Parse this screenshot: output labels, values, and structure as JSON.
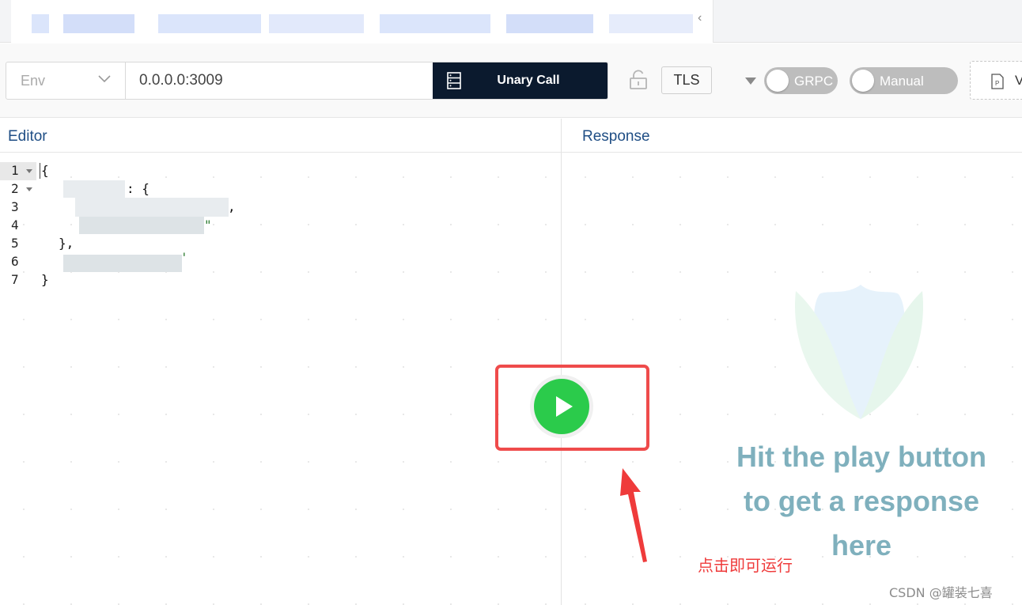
{
  "toolbar": {
    "env_placeholder": "Env",
    "address_value": "0.0.0.0:3009",
    "call_type_label": "Unary Call",
    "tls_label": "TLS",
    "grpc_toggle_label": "GRPC",
    "manual_toggle_label": "Manual",
    "file_button_label": "V"
  },
  "editor": {
    "header": "Editor",
    "line_numbers": [
      "1",
      "2",
      "3",
      "4",
      "5",
      "6",
      "7"
    ],
    "lines": [
      "{",
      ": {",
      ",",
      "\"",
      "},",
      "'",
      "}"
    ]
  },
  "response": {
    "header": "Response",
    "hint_lines": [
      "Hit the play button",
      "to get a response",
      "here"
    ]
  },
  "annotation": {
    "text": "点击即可运行",
    "color": "#ef4b4b"
  },
  "watermark": "CSDN @罐装七喜",
  "colors": {
    "play": "#2bcb4b",
    "call_button_bg": "#0b1a2e",
    "header_text": "#1f4e85",
    "hint_text": "#7fb0bd"
  },
  "icons": {
    "play": "play-icon",
    "lock": "unlock-icon",
    "call": "server-icon",
    "file": "proto-file-icon"
  }
}
